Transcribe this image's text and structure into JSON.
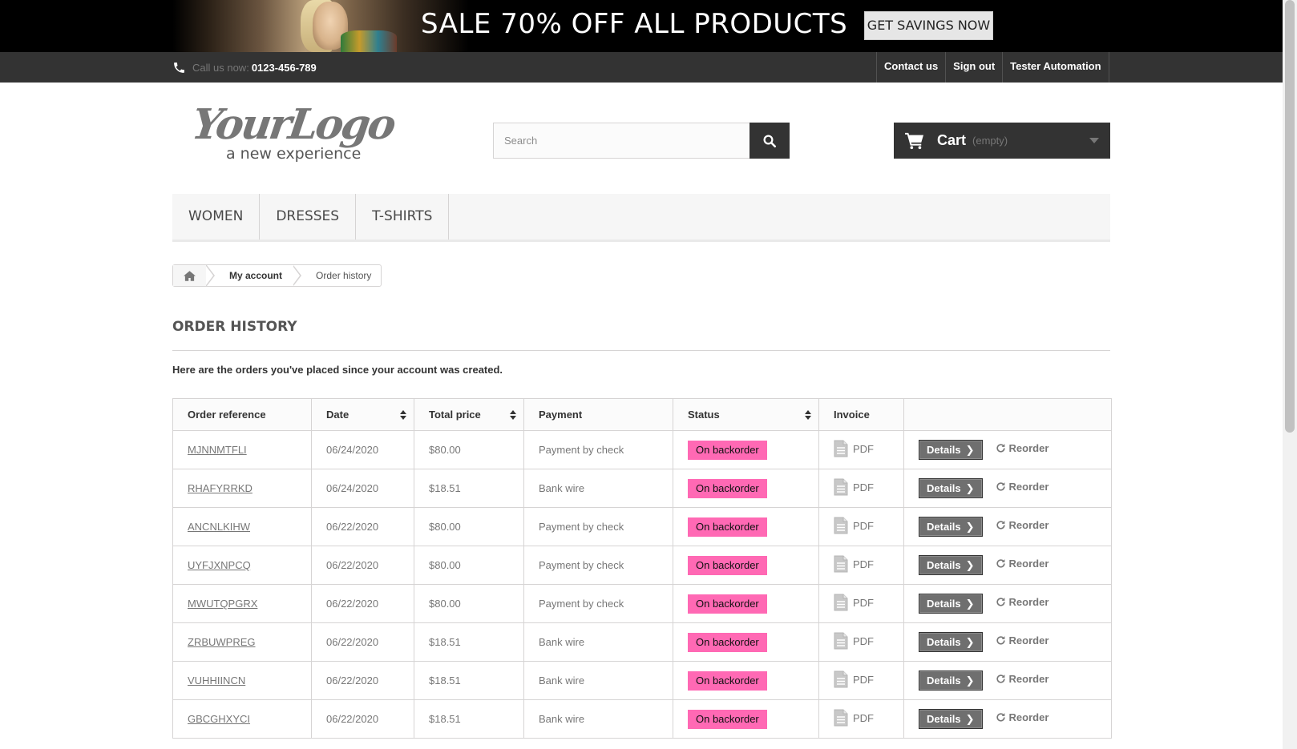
{
  "banner": {
    "headline": "SALE 70% OFF ALL PRODUCTS",
    "cta_label": "GET SAVINGS NOW"
  },
  "topbar": {
    "call_label": "Call us now:",
    "phone": "0123-456-789",
    "links": [
      "Contact us",
      "Sign out",
      "Tester Automation"
    ]
  },
  "logo": {
    "wordmark": "YourLogo",
    "tagline": "a new experience"
  },
  "search": {
    "placeholder": "Search",
    "button_icon": "search-icon"
  },
  "cart": {
    "label": "Cart",
    "status": "(empty)"
  },
  "menu": {
    "items": [
      "WOMEN",
      "DRESSES",
      "T-SHIRTS"
    ]
  },
  "breadcrumb": {
    "home_icon": "home-icon",
    "items": [
      "My account",
      "Order history"
    ]
  },
  "page": {
    "title": "ORDER HISTORY",
    "intro": "Here are the orders you've placed since your account was created."
  },
  "table": {
    "headers": [
      "Order reference",
      "Date",
      "Total price",
      "Payment",
      "Status",
      "Invoice",
      ""
    ],
    "pdf_label": "PDF",
    "details_label": "Details",
    "reorder_label": "Reorder",
    "rows": [
      {
        "ref": "MJNNMTFLI",
        "date": "06/24/2020",
        "total": "$80.00",
        "payment": "Payment by check",
        "status": "On backorder"
      },
      {
        "ref": "RHAFYRRKD",
        "date": "06/24/2020",
        "total": "$18.51",
        "payment": "Bank wire",
        "status": "On backorder"
      },
      {
        "ref": "ANCNLKIHW",
        "date": "06/22/2020",
        "total": "$80.00",
        "payment": "Payment by check",
        "status": "On backorder"
      },
      {
        "ref": "UYFJXNPCQ",
        "date": "06/22/2020",
        "total": "$80.00",
        "payment": "Payment by check",
        "status": "On backorder"
      },
      {
        "ref": "MWUTQPGRX",
        "date": "06/22/2020",
        "total": "$80.00",
        "payment": "Payment by check",
        "status": "On backorder"
      },
      {
        "ref": "ZRBUWPREG",
        "date": "06/22/2020",
        "total": "$18.51",
        "payment": "Bank wire",
        "status": "On backorder"
      },
      {
        "ref": "VUHHIINCN",
        "date": "06/22/2020",
        "total": "$18.51",
        "payment": "Bank wire",
        "status": "On backorder"
      },
      {
        "ref": "GBCGHXYCI",
        "date": "06/22/2020",
        "total": "$18.51",
        "payment": "Bank wire",
        "status": "On backorder"
      }
    ]
  },
  "colors": {
    "status_badge": "#ff69b4",
    "dark": "#333333",
    "details_button": "#6f6f6f"
  }
}
